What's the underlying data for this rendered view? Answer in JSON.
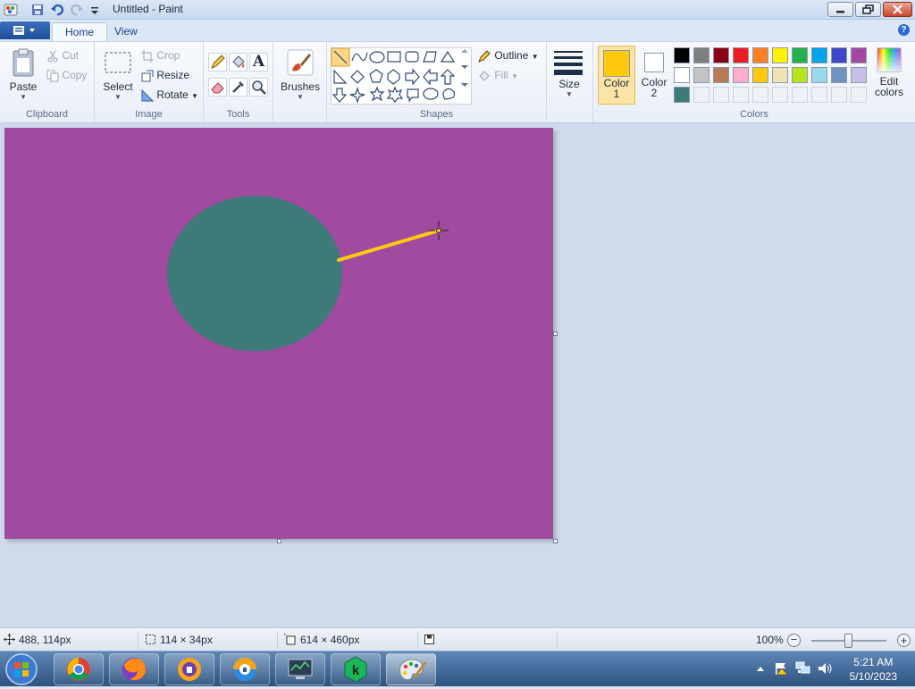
{
  "window": {
    "title": "Untitled - Paint"
  },
  "tabs": [
    {
      "label": "Home",
      "active": true
    },
    {
      "label": "View",
      "active": false
    }
  ],
  "ribbon": {
    "clipboard": {
      "label": "Clipboard",
      "paste": "Paste",
      "cut": "Cut",
      "copy": "Copy"
    },
    "image": {
      "label": "Image",
      "select": "Select",
      "crop": "Crop",
      "resize": "Resize",
      "rotate": "Rotate"
    },
    "tools": {
      "label": "Tools"
    },
    "brushes": {
      "label": "Brushes"
    },
    "shapes": {
      "label": "Shapes",
      "outline": "Outline",
      "fill": "Fill"
    },
    "size": {
      "label": "Size"
    },
    "colors": {
      "label": "Colors",
      "color1_label_line1": "Color",
      "color1_label_line2": "1",
      "color2_label_line1": "Color",
      "color2_label_line2": "2",
      "edit_line1": "Edit",
      "edit_line2": "colors",
      "color1": "#ffc90e",
      "color2": "#ffffff",
      "palette_row1": [
        "#000000",
        "#7f7f7f",
        "#880015",
        "#ed1c24",
        "#ff7f27",
        "#fff200",
        "#22b14c",
        "#00a2e8",
        "#3f48cc",
        "#a349a4"
      ],
      "palette_row2": [
        "#ffffff",
        "#c3c3c3",
        "#b97a57",
        "#ffaec9",
        "#ffc90e",
        "#efe4b0",
        "#b5e61d",
        "#99d9ea",
        "#7092be",
        "#c8bfe7"
      ],
      "palette_row3": [
        "#3d7a78"
      ]
    }
  },
  "canvas": {
    "background": "#a04b9f",
    "ellipse_color": "#3d7a78",
    "line_color": "#ffc90e"
  },
  "status": {
    "cursor_pos": "488, 114px",
    "selection_size": "114 × 34px",
    "canvas_size": "614 × 460px",
    "zoom": "100%"
  },
  "taskbar": {
    "time": "5:21 AM",
    "date": "5/10/2023"
  }
}
